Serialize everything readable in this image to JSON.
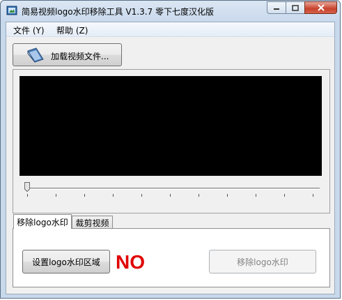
{
  "window": {
    "title": "简易视频logo水印移除工具 V1.3.7 零下七度汉化版"
  },
  "menu": {
    "file": "文件 (Y)",
    "help": "帮助 (Z)"
  },
  "toolbar": {
    "load_label": "加载视频文件..."
  },
  "tabs": [
    {
      "label": "移除logo水印",
      "active": true
    },
    {
      "label": "裁剪视频",
      "active": false
    }
  ],
  "panel": {
    "set_area_label": "设置logo水印区域",
    "status_text": "NO",
    "remove_label": "移除logo水印"
  },
  "colors": {
    "status": "#e00000",
    "video_bg": "#000000"
  }
}
